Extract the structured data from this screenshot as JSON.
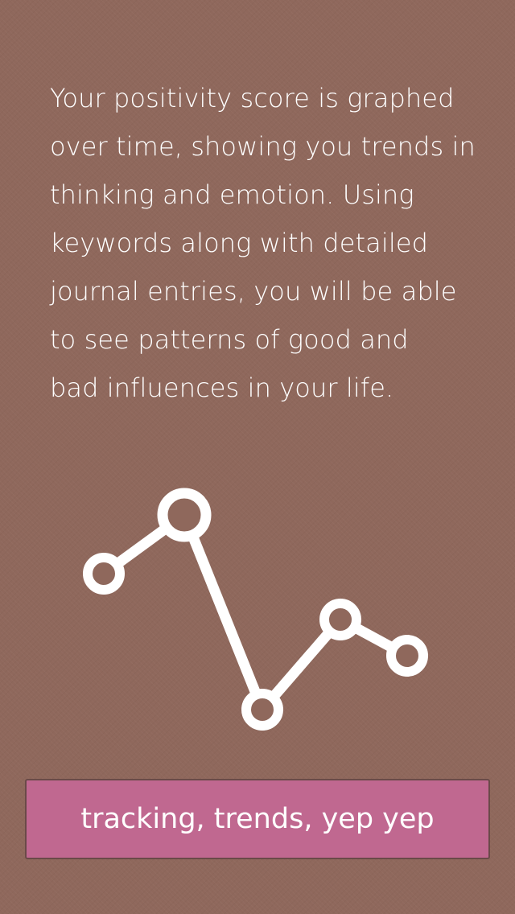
{
  "description": {
    "lines": [
      "Your positivity score is graphed",
      "over time, showing you trends in",
      "thinking and emotion. Using",
      "keywords along with detailed",
      "journal entries, you will be able",
      "to see patterns of good and",
      "bad influences in your life."
    ]
  },
  "graph": {
    "icon": "line-graph-icon",
    "points": [
      3,
      5,
      -1,
      2,
      1
    ]
  },
  "cta": {
    "label": "tracking, trends, yep yep"
  },
  "colors": {
    "background": "#8f685c",
    "button": "#c06890",
    "foreground": "#ffffff"
  }
}
